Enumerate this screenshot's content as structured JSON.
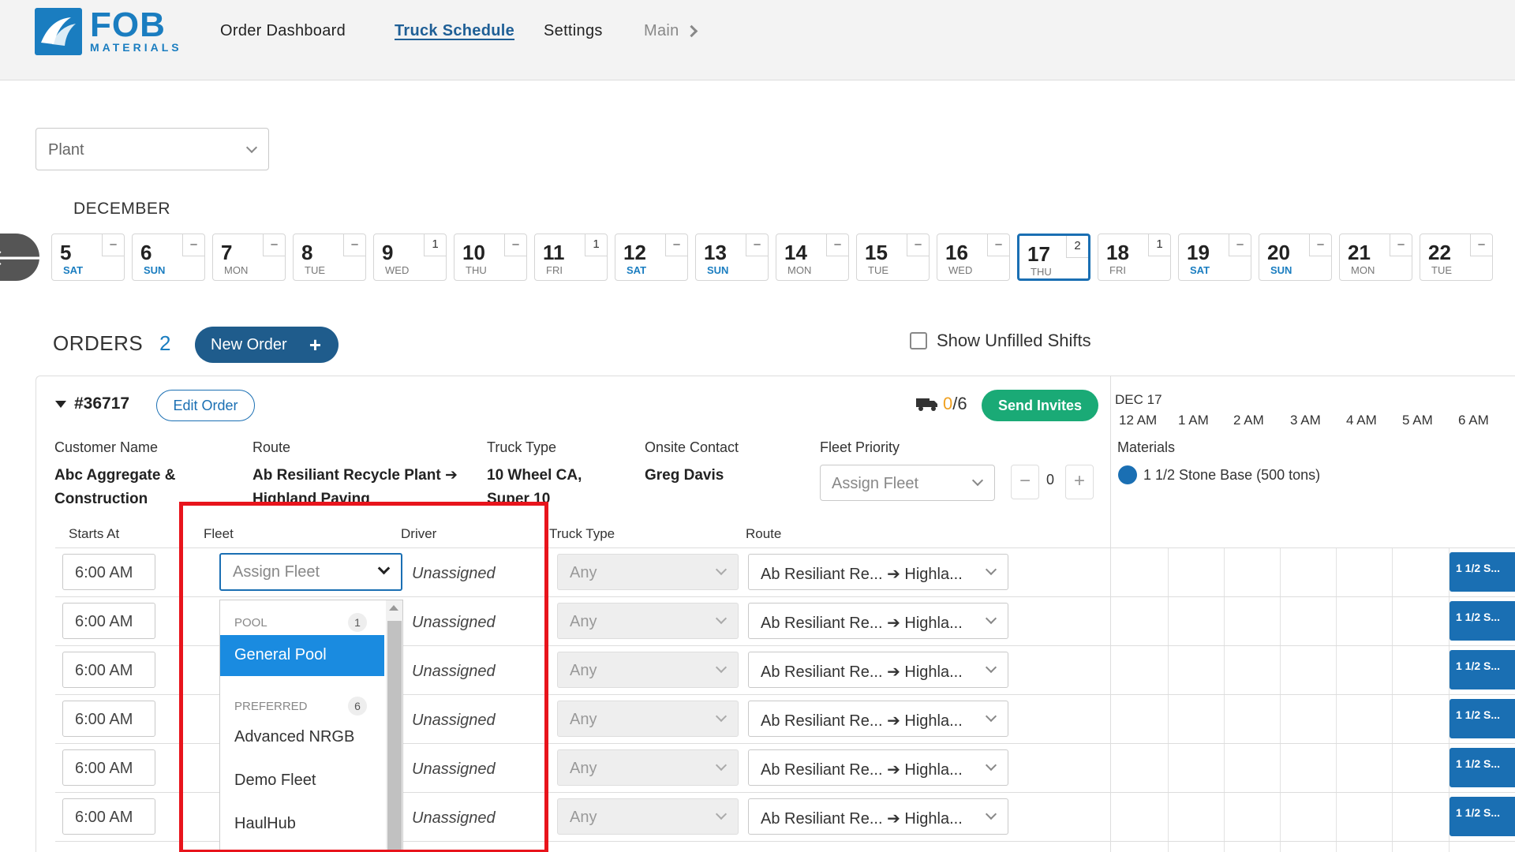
{
  "header": {
    "logo_big": "FOB",
    "logo_small": "MATERIALS",
    "nav": [
      {
        "label": "Order Dashboard"
      },
      {
        "label": "Truck Schedule"
      },
      {
        "label": "Settings"
      },
      {
        "label": "Main"
      }
    ]
  },
  "plant_placeholder": "Plant",
  "month": "DECEMBER",
  "dates": [
    {
      "num": "5",
      "dow": "SAT",
      "count": "–"
    },
    {
      "num": "6",
      "dow": "SUN",
      "count": "–"
    },
    {
      "num": "7",
      "dow": "MON",
      "count": "–"
    },
    {
      "num": "8",
      "dow": "TUE",
      "count": "–"
    },
    {
      "num": "9",
      "dow": "WED",
      "count": "1"
    },
    {
      "num": "10",
      "dow": "THU",
      "count": "–"
    },
    {
      "num": "11",
      "dow": "FRI",
      "count": "1"
    },
    {
      "num": "12",
      "dow": "SAT",
      "count": "–"
    },
    {
      "num": "13",
      "dow": "SUN",
      "count": "–"
    },
    {
      "num": "14",
      "dow": "MON",
      "count": "–"
    },
    {
      "num": "15",
      "dow": "TUE",
      "count": "–"
    },
    {
      "num": "16",
      "dow": "WED",
      "count": "–"
    },
    {
      "num": "17",
      "dow": "THU",
      "count": "2"
    },
    {
      "num": "18",
      "dow": "FRI",
      "count": "1"
    },
    {
      "num": "19",
      "dow": "SAT",
      "count": "–"
    },
    {
      "num": "20",
      "dow": "SUN",
      "count": "–"
    },
    {
      "num": "21",
      "dow": "MON",
      "count": "–"
    },
    {
      "num": "22",
      "dow": "TUE",
      "count": "–"
    }
  ],
  "selected_date": "17",
  "orders": {
    "title": "ORDERS",
    "count": "2",
    "new_order_label": "New Order",
    "show_unfilled_label": "Show Unfilled Shifts"
  },
  "order": {
    "number": "#36717",
    "edit_label": "Edit Order",
    "trucks_filled": "0",
    "trucks_total": "/6",
    "send_invites_label": "Send Invites",
    "labels": {
      "customer": "Customer Name",
      "route": "Route",
      "truck_type": "Truck Type",
      "onsite": "Onsite Contact",
      "fleet_priority": "Fleet Priority"
    },
    "customer_line1": "Abc Aggregate &",
    "customer_line2": "Construction",
    "route_line1": "Ab Resiliant Recycle Plant",
    "route_line2": "Highland Paving",
    "truck_type_line1": "10 Wheel CA,",
    "truck_type_line2": "Super 10",
    "onsite_contact": "Greg Davis",
    "fleet_priority_placeholder": "Assign Fleet",
    "priority_value": "0"
  },
  "timeline": {
    "date": "DEC 17",
    "hours": [
      "12 AM",
      "1 AM",
      "2 AM",
      "3 AM",
      "4 AM",
      "5 AM",
      "6 AM"
    ],
    "materials_label": "Materials",
    "material": "1 1/2 Stone Base (500 tons)",
    "material_color": "#1a6fb3"
  },
  "shift_headers": {
    "starts_at": "Starts At",
    "fleet": "Fleet",
    "driver": "Driver",
    "truck_type": "Truck Type",
    "route": "Route"
  },
  "shifts": [
    {
      "time": "6:00 AM",
      "driver": "Unassigned",
      "truck_type": "Any",
      "route_from": "Ab Resiliant Re...",
      "route_to": "Highla...",
      "tag": "1 1/2 S..."
    },
    {
      "time": "6:00 AM",
      "driver": "Unassigned",
      "truck_type": "Any",
      "route_from": "Ab Resiliant Re...",
      "route_to": "Highla...",
      "tag": "1 1/2 S..."
    },
    {
      "time": "6:00 AM",
      "driver": "Unassigned",
      "truck_type": "Any",
      "route_from": "Ab Resiliant Re...",
      "route_to": "Highla...",
      "tag": "1 1/2 S..."
    },
    {
      "time": "6:00 AM",
      "driver": "Unassigned",
      "truck_type": "Any",
      "route_from": "Ab Resiliant Re...",
      "route_to": "Highla...",
      "tag": "1 1/2 S..."
    },
    {
      "time": "6:00 AM",
      "driver": "Unassigned",
      "truck_type": "Any",
      "route_from": "Ab Resiliant Re...",
      "route_to": "Highla...",
      "tag": "1 1/2 S..."
    },
    {
      "time": "6:00 AM",
      "driver": "Unassigned",
      "truck_type": "Any",
      "route_from": "Ab Resiliant Re...",
      "route_to": "Highla...",
      "tag": "1 1/2 S..."
    }
  ],
  "fleet_dropdown": {
    "placeholder": "Assign Fleet",
    "pool_label": "POOL",
    "pool_count": "1",
    "pool_items": [
      "General Pool"
    ],
    "preferred_label": "PREFERRED",
    "preferred_count": "6",
    "preferred_items": [
      "Advanced NRGB",
      "Demo Fleet",
      "HaulHub"
    ]
  },
  "colors": {
    "brand": "#1a7dc0",
    "primary_dark": "#1f5c8c",
    "success": "#1aaa76",
    "highlight": "#e8141c",
    "menu_active": "#1a8be0"
  }
}
